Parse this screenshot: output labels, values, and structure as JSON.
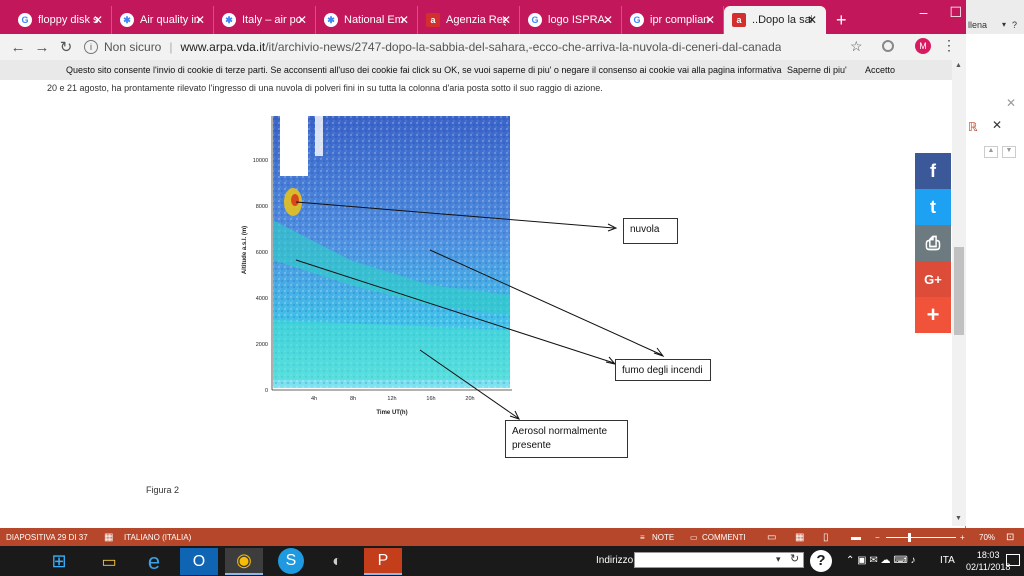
{
  "browser": {
    "tabs": [
      {
        "title": "floppy disk su",
        "icon": "google-icon"
      },
      {
        "title": "Air quality ind",
        "icon": "gear-favicon"
      },
      {
        "title": "Italy – air pol",
        "icon": "gear-favicon"
      },
      {
        "title": "National Emi",
        "icon": "gear-favicon"
      },
      {
        "title": "Agenzia Regi",
        "icon": "arpa-favicon"
      },
      {
        "title": "logo ISPRA -",
        "icon": "google-icon"
      },
      {
        "title": "ipr complian",
        "icon": "google-icon"
      },
      {
        "title": "..Dopo la sab",
        "icon": "arpa-favicon",
        "active": true
      }
    ],
    "security_label": "Non sicuro",
    "url_host": "www.arpa.vda.it",
    "url_path": "/it/archivio-news/2747-dopo-la-sabbia-del-sahara,-ecco-che-arriva-la-nuvola-di-ceneri-dal-canada",
    "avatar_letter": "M",
    "accent_color": "#c2185b"
  },
  "cookie_bar": {
    "message": "Questo sito consente l'invio di cookie di terze parti. Se acconsenti all'uso dei cookie fai click su OK, se vuoi saperne di piu' o negare il consenso ai cookie vai alla pagina informativa",
    "more_link": "Saperne di piu'",
    "accept": "Accetto"
  },
  "article": {
    "intro": "20 e 21 agosto, ha prontamente rilevato l'ingresso di una nuvola di polveri fini in su tutta la colonna d'aria posta sotto il suo raggio di azione.",
    "figure_caption": "Figura 2"
  },
  "figure": {
    "ylabel": "Altitude a.s.l. (m)",
    "xlabel": "Time UT(h)",
    "yticks": [
      "10000",
      "8000",
      "6000",
      "4000",
      "2000",
      "0"
    ],
    "xticks": [
      "4h",
      "8h",
      "12h",
      "16h",
      "20h"
    ],
    "callouts": {
      "nuvola": "nuvola",
      "fumo": "fumo degli incendi",
      "aerosol": "Aerosol normalmente presente"
    }
  },
  "share": {
    "facebook": "f",
    "twitter": "t",
    "print": "⎙",
    "google": "G+",
    "more": "+"
  },
  "ppt_pane": {
    "user_fragment": "llena"
  },
  "statusbar": {
    "slide": "DIAPOSITIVA 29 DI 37",
    "language": "ITALIANO (ITALIA)",
    "notes": "NOTE",
    "comments": "COMMENTI",
    "zoom": "70%"
  },
  "taskbar": {
    "address_label": "Indirizzo",
    "lang": "ITA",
    "time": "18:03",
    "date": "02/11/2018"
  }
}
